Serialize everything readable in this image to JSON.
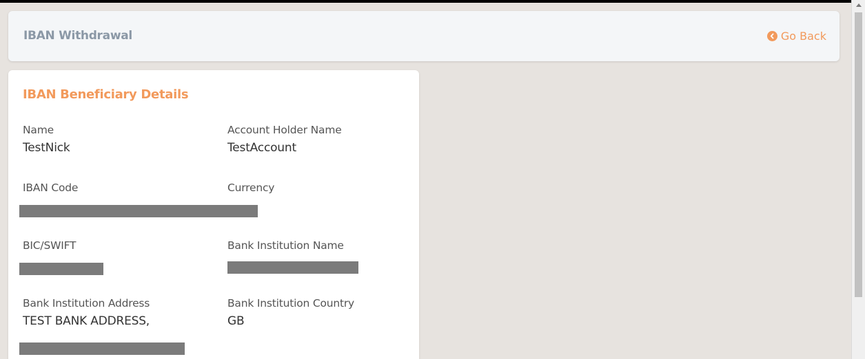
{
  "header": {
    "title": "IBAN Withdrawal",
    "go_back_label": "Go Back"
  },
  "card": {
    "title": "IBAN Beneficiary Details",
    "fields": [
      {
        "label": "Name",
        "value": "TestNick"
      },
      {
        "label": "Account Holder Name",
        "value": "TestAccount"
      },
      {
        "label": "IBAN Code",
        "value": ""
      },
      {
        "label": "Currency",
        "value": ""
      },
      {
        "label": "BIC/SWIFT",
        "value": ""
      },
      {
        "label": "Bank Institution Name",
        "value": ""
      },
      {
        "label": "Bank Institution Address",
        "value": "TEST BANK ADDRESS,"
      },
      {
        "label": "Bank Institution Country",
        "value": "GB"
      }
    ]
  },
  "colors": {
    "accent": "#f29a5c",
    "title_gray": "#8b98a6",
    "background": "#e7e3df",
    "redaction": "#7b7b7b"
  },
  "icons": {
    "back": "chevron-left-circle-icon",
    "scroll_up": "arrow-up-icon"
  }
}
